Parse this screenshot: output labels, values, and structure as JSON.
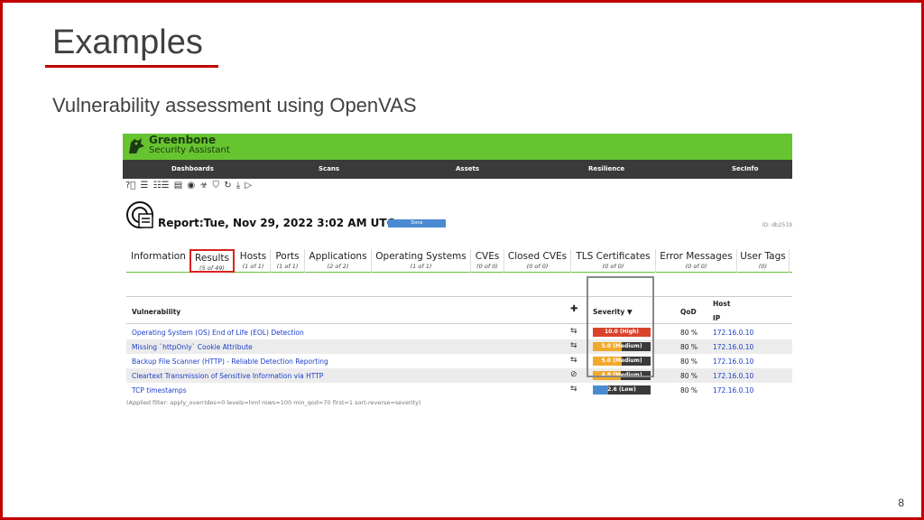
{
  "slide": {
    "title": "Examples",
    "subtitle": "Vulnerability assessment using OpenVAS",
    "page_number": "8"
  },
  "app": {
    "brand_line1": "Greenbone",
    "brand_line2": "Security Assistant",
    "nav": [
      "Dashboards",
      "Scans",
      "Assets",
      "Resilience",
      "SecInfo"
    ]
  },
  "report": {
    "title": "Report:Tue, Nov 29, 2022 3:02 AM UTC",
    "status": "Done",
    "id": "ID: db2519"
  },
  "tabs": [
    {
      "label": "Information",
      "count": ""
    },
    {
      "label": "Results",
      "count": "(5 of 49)"
    },
    {
      "label": "Hosts",
      "count": "(1 of 1)"
    },
    {
      "label": "Ports",
      "count": "(1 of 1)"
    },
    {
      "label": "Applications",
      "count": "(2 of 2)"
    },
    {
      "label": "Operating Systems",
      "count": "(1 of 1)"
    },
    {
      "label": "CVEs",
      "count": "(0 of 0)"
    },
    {
      "label": "Closed CVEs",
      "count": "(0 of 0)"
    },
    {
      "label": "TLS Certificates",
      "count": "(0 of 0)"
    },
    {
      "label": "Error Messages",
      "count": "(0 of 0)"
    },
    {
      "label": "User Tags",
      "count": "(0)"
    }
  ],
  "table": {
    "col_vulnerability": "Vulnerability",
    "col_severity": "Severity ▼",
    "col_qod": "QoD",
    "col_host": "Host",
    "col_ip": "IP",
    "rows": [
      {
        "vuln": "Operating System (OS) End of Life (EOL) Detection",
        "sev": "10.0 (High)",
        "sev_value": 10.0,
        "color": "#d9432c",
        "qod": "80 %",
        "ip": "172.16.0.10"
      },
      {
        "vuln": "Missing `httpOnly` Cookie Attribute",
        "sev": "5.0 (Medium)",
        "sev_value": 5.0,
        "color": "#f0a92a",
        "qod": "80 %",
        "ip": "172.16.0.10"
      },
      {
        "vuln": "Backup File Scanner (HTTP) - Reliable Detection Reporting",
        "sev": "5.0 (Medium)",
        "sev_value": 5.0,
        "color": "#f0a92a",
        "qod": "80 %",
        "ip": "172.16.0.10"
      },
      {
        "vuln": "Cleartext Transmission of Sensitive Information via HTTP",
        "sev": "4.8 (Medium)",
        "sev_value": 4.8,
        "color": "#f0a92a",
        "qod": "80 %",
        "ip": "172.16.0.10"
      },
      {
        "vuln": "TCP timestamps",
        "sev": "2.6 (Low)",
        "sev_value": 2.6,
        "color": "#4b8ad0",
        "qod": "80 %",
        "ip": "172.16.0.10"
      }
    ]
  },
  "applied_filter": "(Applied filter: apply_overrides=0 levels=hml rows=100 min_qod=70 first=1 sort-reverse=severity)"
}
